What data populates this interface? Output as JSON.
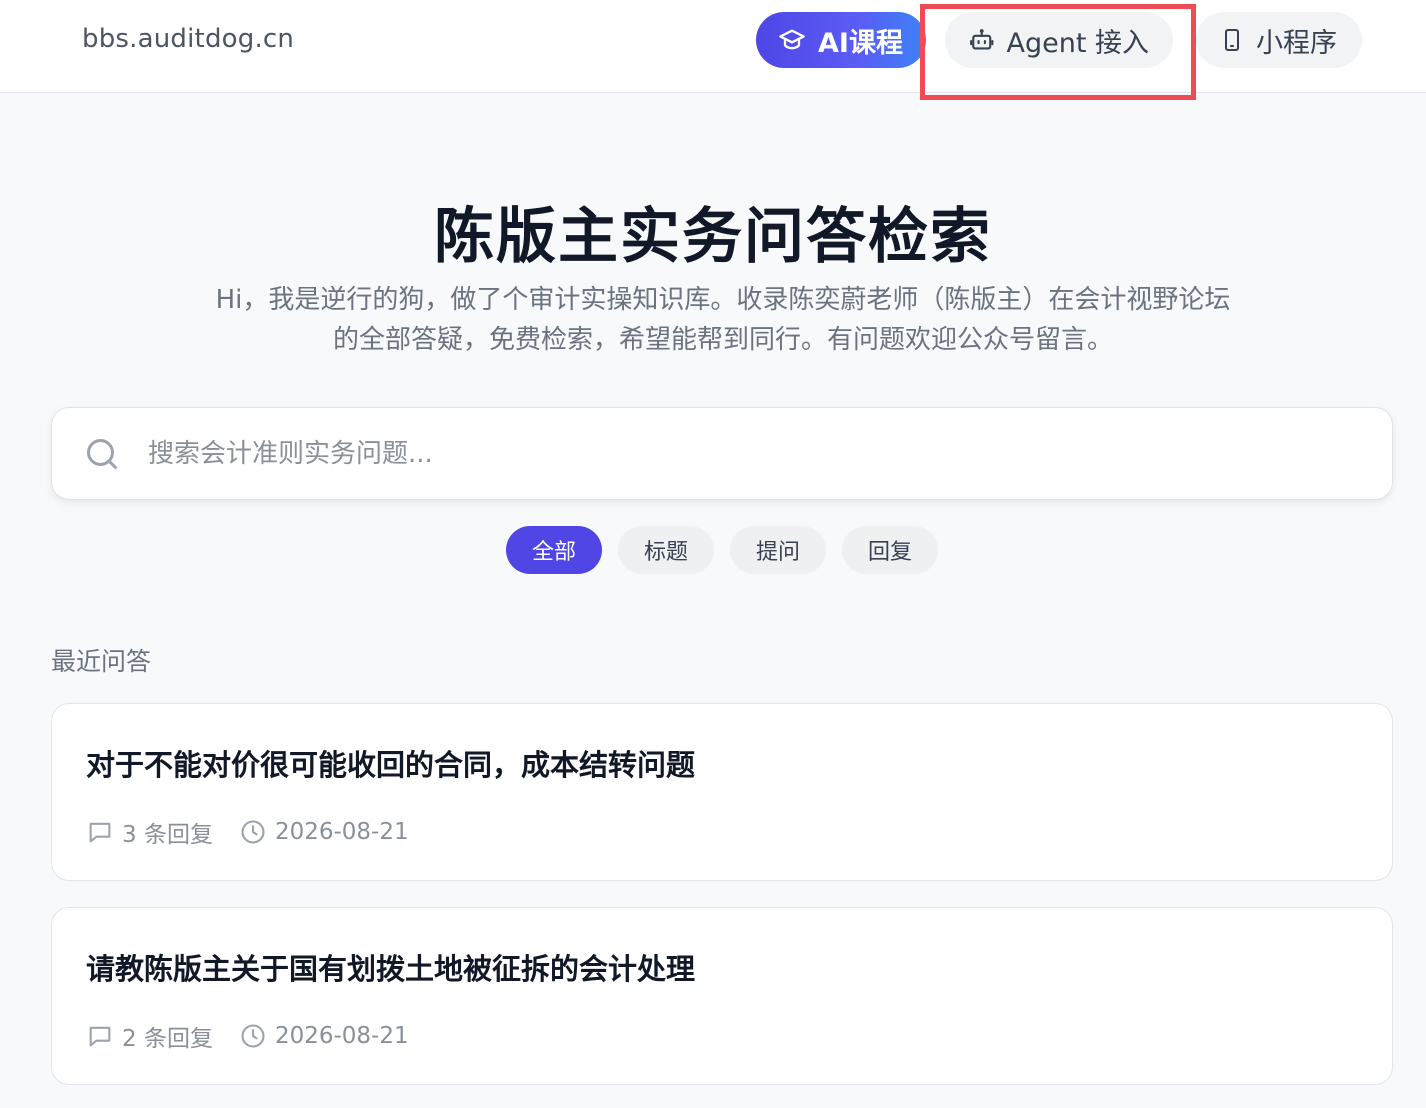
{
  "header": {
    "domain": "bbs.auditdog.cn",
    "nav": {
      "ai_course": "AI课程",
      "agent": "Agent 接入",
      "mini_program": "小程序"
    }
  },
  "hero": {
    "title": "陈版主实务问答检索",
    "subtitle": "Hi，我是逆行的狗，做了个审计实操知识库。收录陈奕蔚老师（陈版主）在会计视野论坛的全部答疑，免费检索，希望能帮到同行。有问题欢迎公众号留言。"
  },
  "search": {
    "placeholder": "搜索会计准则实务问题...",
    "value": ""
  },
  "filters": [
    "全部",
    "标题",
    "提问",
    "回复"
  ],
  "section_label": "最近问答",
  "posts": [
    {
      "title": "对于不能对价很可能收回的合同，成本结转问题",
      "replies": "3 条回复",
      "date": "2026-08-21"
    },
    {
      "title": "请教陈版主关于国有划拨土地被征拆的会计处理",
      "replies": "2 条回复",
      "date": "2026-08-21"
    }
  ],
  "colors": {
    "accent": "#4f46e5",
    "highlight": "#ef4b55"
  }
}
